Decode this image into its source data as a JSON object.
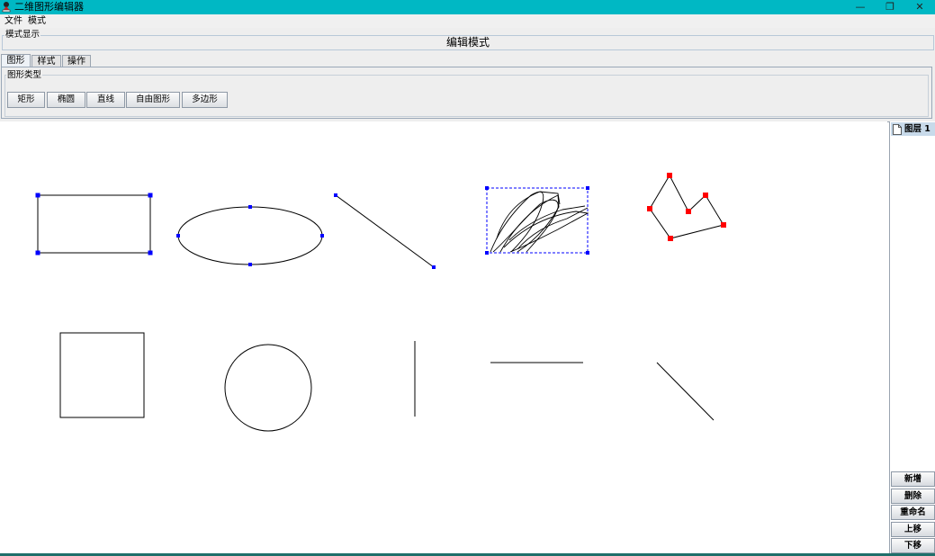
{
  "window": {
    "title": "二维图形编辑器",
    "colors": {
      "titlebar": "#00b8c4",
      "selection_handle": "#0000ff",
      "polygon_handle": "#ff0000"
    },
    "controls": {
      "minimize": "—",
      "restore": "❐",
      "close": "✕"
    }
  },
  "menu": {
    "items": [
      "文件",
      "模式"
    ]
  },
  "mode_display": {
    "group_label": "模式显示",
    "text": "编辑模式"
  },
  "tabs": [
    {
      "label": "图形",
      "active": true
    },
    {
      "label": "样式",
      "active": false
    },
    {
      "label": "操作",
      "active": false
    }
  ],
  "shape_panel": {
    "group_label": "图形类型",
    "buttons": [
      "矩形",
      "椭圆",
      "直线",
      "自由图形",
      "多边形"
    ]
  },
  "layer_panel": {
    "layers": [
      {
        "name": "图层 1",
        "selected": true
      }
    ],
    "buttons": [
      "新增",
      "删除",
      "重命名",
      "上移",
      "下移"
    ]
  },
  "canvas": {
    "shapes": [
      {
        "type": "rectangle",
        "selected": true
      },
      {
        "type": "ellipse",
        "selected": true
      },
      {
        "type": "line",
        "selected": true
      },
      {
        "type": "freehand",
        "selected": true
      },
      {
        "type": "polygon",
        "selected": true
      },
      {
        "type": "square",
        "selected": false
      },
      {
        "type": "circle",
        "selected": false
      },
      {
        "type": "line",
        "selected": false
      },
      {
        "type": "line",
        "selected": false
      },
      {
        "type": "line",
        "selected": false
      }
    ]
  }
}
